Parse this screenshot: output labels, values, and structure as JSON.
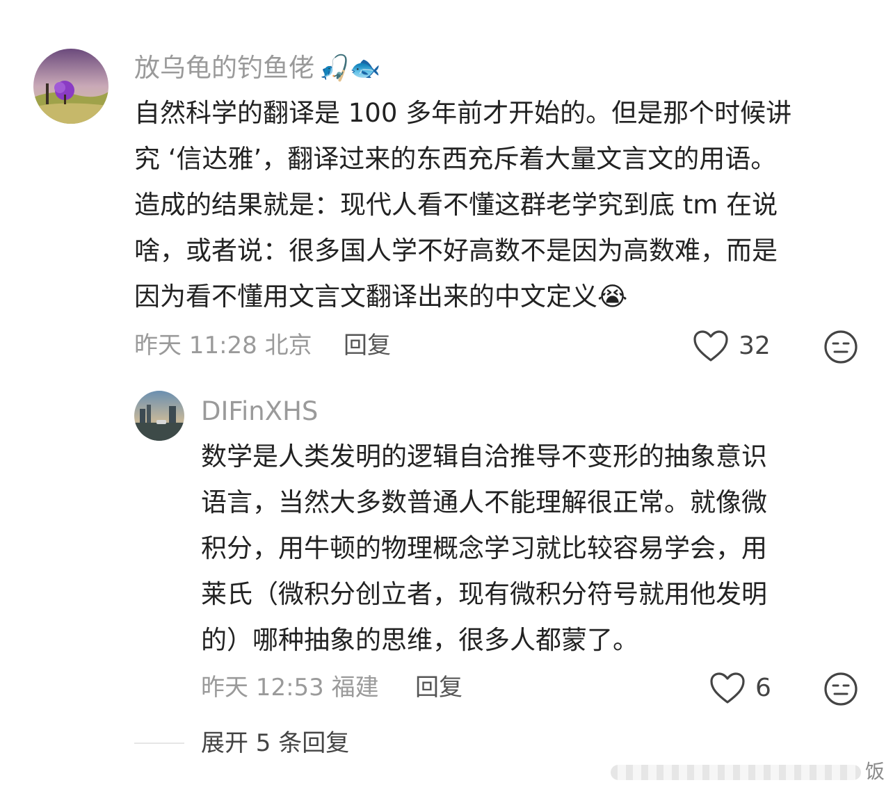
{
  "comment": {
    "username": "放乌龟的钓鱼佬",
    "username_emoji": "🎣🐟",
    "text_lines": [
      "自然科学的翻译是 100 多年前才开始的。但是那个时候讲",
      "究 ‘信达雅’，翻译过来的东西充斥着大量文言文的用语。",
      "造成的结果就是：现代人看不懂这群老学究到底 tm 在说",
      "啥，或者说：很多国人学不好高数不是因为高数难，而是",
      "因为看不懂用文言文翻译出来的中文定义"
    ],
    "text_emoji": "😭",
    "meta": "昨天 11:28 北京",
    "reply_label": "回复",
    "like_count": "32",
    "icons": {
      "like": "heart-outline-icon",
      "dislike": "meh-face-icon"
    }
  },
  "reply": {
    "username": "DIFinXHS",
    "text_lines": [
      "数学是人类发明的逻辑自洽推导不变形的抽象意识",
      "语言，当然大多数普通人不能理解很正常。就像微",
      "积分，用牛顿的物理概念学习就比较容易学会，用",
      "莱氏（微积分创立者，现有微积分符号就用他发明",
      "的）哪种抽象的思维，很多人都蒙了。"
    ],
    "meta": "昨天 12:53 福建",
    "reply_label": "回复",
    "like_count": "6"
  },
  "expand_label": "展开 5 条回复",
  "watermark": "饭"
}
